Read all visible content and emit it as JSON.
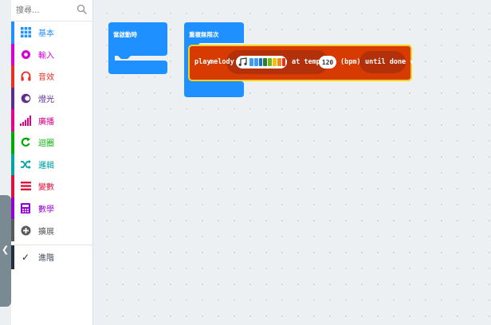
{
  "search": {
    "placeholder": "搜尋..."
  },
  "categories": [
    {
      "label": "基本",
      "color": "#1e90ff",
      "icon": "grid-icon"
    },
    {
      "label": "輸入",
      "color": "#d400d4",
      "icon": "target-icon"
    },
    {
      "label": "音效",
      "color": "#e63022",
      "icon": "headphones-icon"
    },
    {
      "label": "燈光",
      "color": "#5c2d91",
      "icon": "toggle-icon"
    },
    {
      "label": "廣播",
      "color": "#e3008c",
      "icon": "signal-bars-icon"
    },
    {
      "label": "迴圈",
      "color": "#00aa00",
      "icon": "loop-arrow-icon"
    },
    {
      "label": "邏輯",
      "color": "#00a4a6",
      "icon": "shuffle-icon"
    },
    {
      "label": "變數",
      "color": "#dc143c",
      "icon": "list-lines-icon"
    },
    {
      "label": "數學",
      "color": "#9400d3",
      "icon": "calculator-icon"
    },
    {
      "label": "擴展",
      "color": "#5a5a5a",
      "icon": "plus-circle-icon"
    }
  ],
  "advanced": {
    "label": "進階",
    "icon": "chevron-down-icon"
  },
  "blocks": {
    "on_start": {
      "label": "當啟動時",
      "color": "#1e90ff"
    },
    "forever": {
      "label": "重複無限次",
      "color": "#1e90ff"
    },
    "play": {
      "color": "#d83b01",
      "play_text": "play",
      "melody_text": "melody",
      "melody_colors": [
        "#3d9df3",
        "#3d9df3",
        "#1f6bd6",
        "#2a7d2a",
        "#7ab317",
        "#f2c10f",
        "#f08a1e",
        "#e63022"
      ],
      "at_tempo_text": "at tempo",
      "tempo_value": "120",
      "bpm_text": "(bpm)",
      "until_done_text": "until done"
    }
  }
}
